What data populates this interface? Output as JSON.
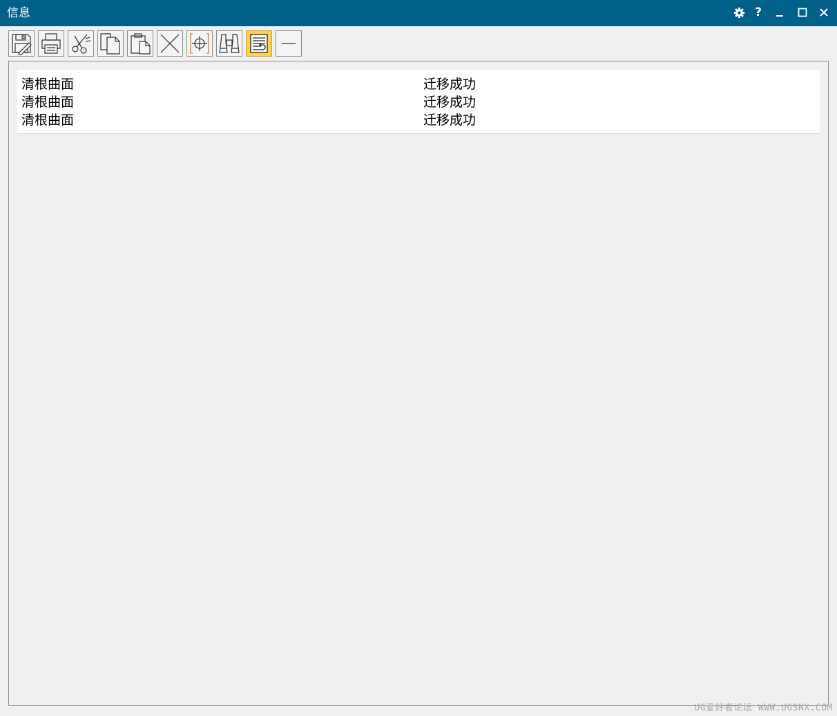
{
  "window": {
    "title": "信息",
    "controls": [
      "gear-icon",
      "help-icon",
      "minimize-icon",
      "maximize-icon",
      "close-icon"
    ]
  },
  "toolbar": {
    "tools": [
      {
        "name": "save-edit-icon"
      },
      {
        "name": "print-icon"
      },
      {
        "name": "cut-icon"
      },
      {
        "name": "copy-icon"
      },
      {
        "name": "paste-icon"
      },
      {
        "name": "delete-icon"
      },
      {
        "name": "crosshair-icon"
      },
      {
        "name": "binoculars-icon"
      },
      {
        "name": "word-wrap-icon",
        "active": true
      },
      {
        "name": "line-icon"
      }
    ],
    "help_label": "?",
    "accent": "#ffd24d"
  },
  "output": {
    "rows": [
      {
        "item": "清根曲面",
        "status": "迁移成功"
      },
      {
        "item": "清根曲面",
        "status": "迁移成功"
      },
      {
        "item": "清根曲面",
        "status": "迁移成功"
      }
    ]
  },
  "watermark": "UG爱好者论坛 WWW.UGSNX.COM",
  "colors": {
    "titlebar": "#00608a",
    "background": "#f0f0f0"
  }
}
